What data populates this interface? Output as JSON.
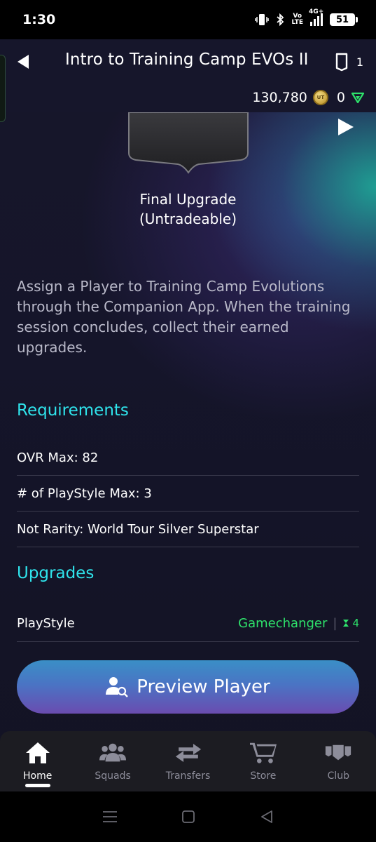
{
  "status_bar": {
    "time": "1:30",
    "network_label_top": "Vo",
    "network_label_bottom": "LTE",
    "signal_label": "4G+",
    "battery": "51"
  },
  "header": {
    "title": "Intro to Training Camp EVOs II",
    "card_count": "1",
    "coins": "130,780",
    "coin_icon_label": "UT",
    "points": "0"
  },
  "reward": {
    "line1": "Final Upgrade",
    "line2": "(Untradeable)"
  },
  "description": "Assign a Player to Training Camp Evolutions through the Companion App. When the training session concludes, collect their earned upgrades.",
  "requirements": {
    "title": "Requirements",
    "items": [
      "OVR Max: 82",
      "# of PlayStyle Max: 3",
      "Not Rarity: World Tour Silver Superstar"
    ]
  },
  "upgrades": {
    "title": "Upgrades",
    "items": [
      {
        "label": "PlayStyle",
        "value": "Gamechanger",
        "duration": "4"
      }
    ]
  },
  "preview_button": {
    "label": "Preview Player"
  },
  "tabs": [
    {
      "label": "Home",
      "icon": "home-icon",
      "active": true
    },
    {
      "label": "Squads",
      "icon": "squads-icon",
      "active": false
    },
    {
      "label": "Transfers",
      "icon": "transfers-icon",
      "active": false
    },
    {
      "label": "Store",
      "icon": "store-icon",
      "active": false
    },
    {
      "label": "Club",
      "icon": "club-icon",
      "active": false
    }
  ],
  "colors": {
    "accent_cyan": "#2fe4ec",
    "upgrade_green": "#2ee36b",
    "background": "#16162b"
  }
}
